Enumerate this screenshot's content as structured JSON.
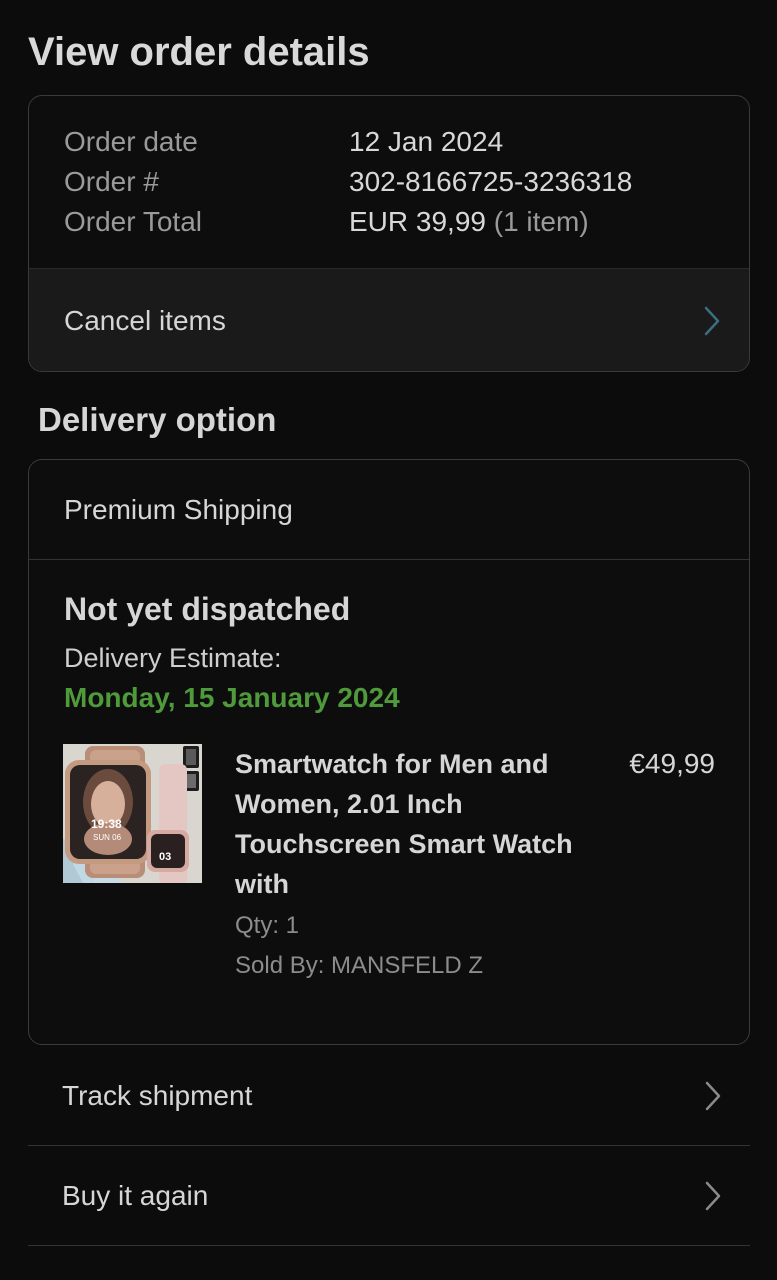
{
  "page_title": "View order details",
  "order_summary": {
    "rows": [
      {
        "label": "Order date",
        "value": "12 Jan 2024",
        "extra": ""
      },
      {
        "label": "Order #",
        "value": "302-8166725-3236318",
        "extra": ""
      },
      {
        "label": "Order Total",
        "value": "EUR 39,99",
        "extra": "(1 item)"
      }
    ],
    "cancel_label": "Cancel items"
  },
  "delivery": {
    "section_title": "Delivery option",
    "shipping_method": "Premium Shipping",
    "status": "Not yet dispatched",
    "estimate_label": "Delivery Estimate:",
    "estimate_date": "Monday, 15 January 2024",
    "estimate_color": "#4f9a3a",
    "item": {
      "title": "Smartwatch for Men and Women, 2.01 Inch Touchscreen Smart Watch with",
      "price": "€49,99",
      "qty": "Qty: 1",
      "sold_by": "Sold By: MANSFELD Z",
      "thumbnail_watch_time": "19:38",
      "thumbnail_watch_date": "SUN 06",
      "thumbnail_small_watch_digits": "03"
    }
  },
  "actions": [
    {
      "label": "Track shipment",
      "icon": "chevron-right-icon"
    },
    {
      "label": "Buy it again",
      "icon": "chevron-right-icon"
    }
  ],
  "colors": {
    "background": "#0c0c0c",
    "card_border": "#3a3a3a",
    "cancel_row_bg": "#1a1a1a",
    "accent_green": "#4f9a3a"
  }
}
